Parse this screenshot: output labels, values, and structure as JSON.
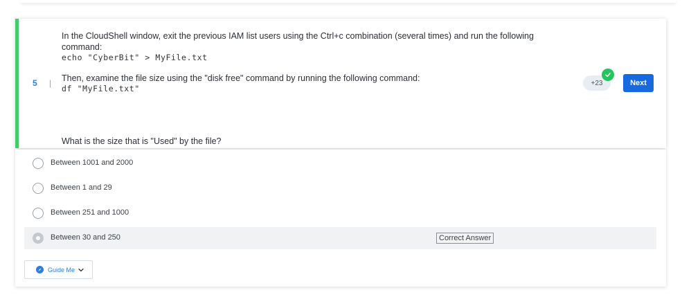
{
  "question": {
    "number": "5",
    "separator": "|",
    "line1": "In the CloudShell window, exit the previous IAM list users using the Ctrl+c combination (several times) and run the following command:",
    "code1": "echo \"CyberBit\" > MyFile.txt",
    "line2": "Then, examine the file size using the \"disk free\" command by running the following command:",
    "code2": "df \"MyFile.txt\"",
    "line3": "What is the size that is \"Used\" by the file?",
    "points": "+23",
    "next_label": "Next"
  },
  "options": [
    {
      "label": "Between 1001 and 2000",
      "selected": false
    },
    {
      "label": "Between 1 and 29",
      "selected": false
    },
    {
      "label": "Between 251 and 1000",
      "selected": false
    },
    {
      "label": "Between 30 and 250",
      "selected": true
    }
  ],
  "correct_answer_tag": "Correct Answer",
  "guide": {
    "label": "Guide Me"
  },
  "colors": {
    "accent_bar": "#3ecf6c",
    "primary": "#1769e0",
    "success": "#22c55e"
  }
}
